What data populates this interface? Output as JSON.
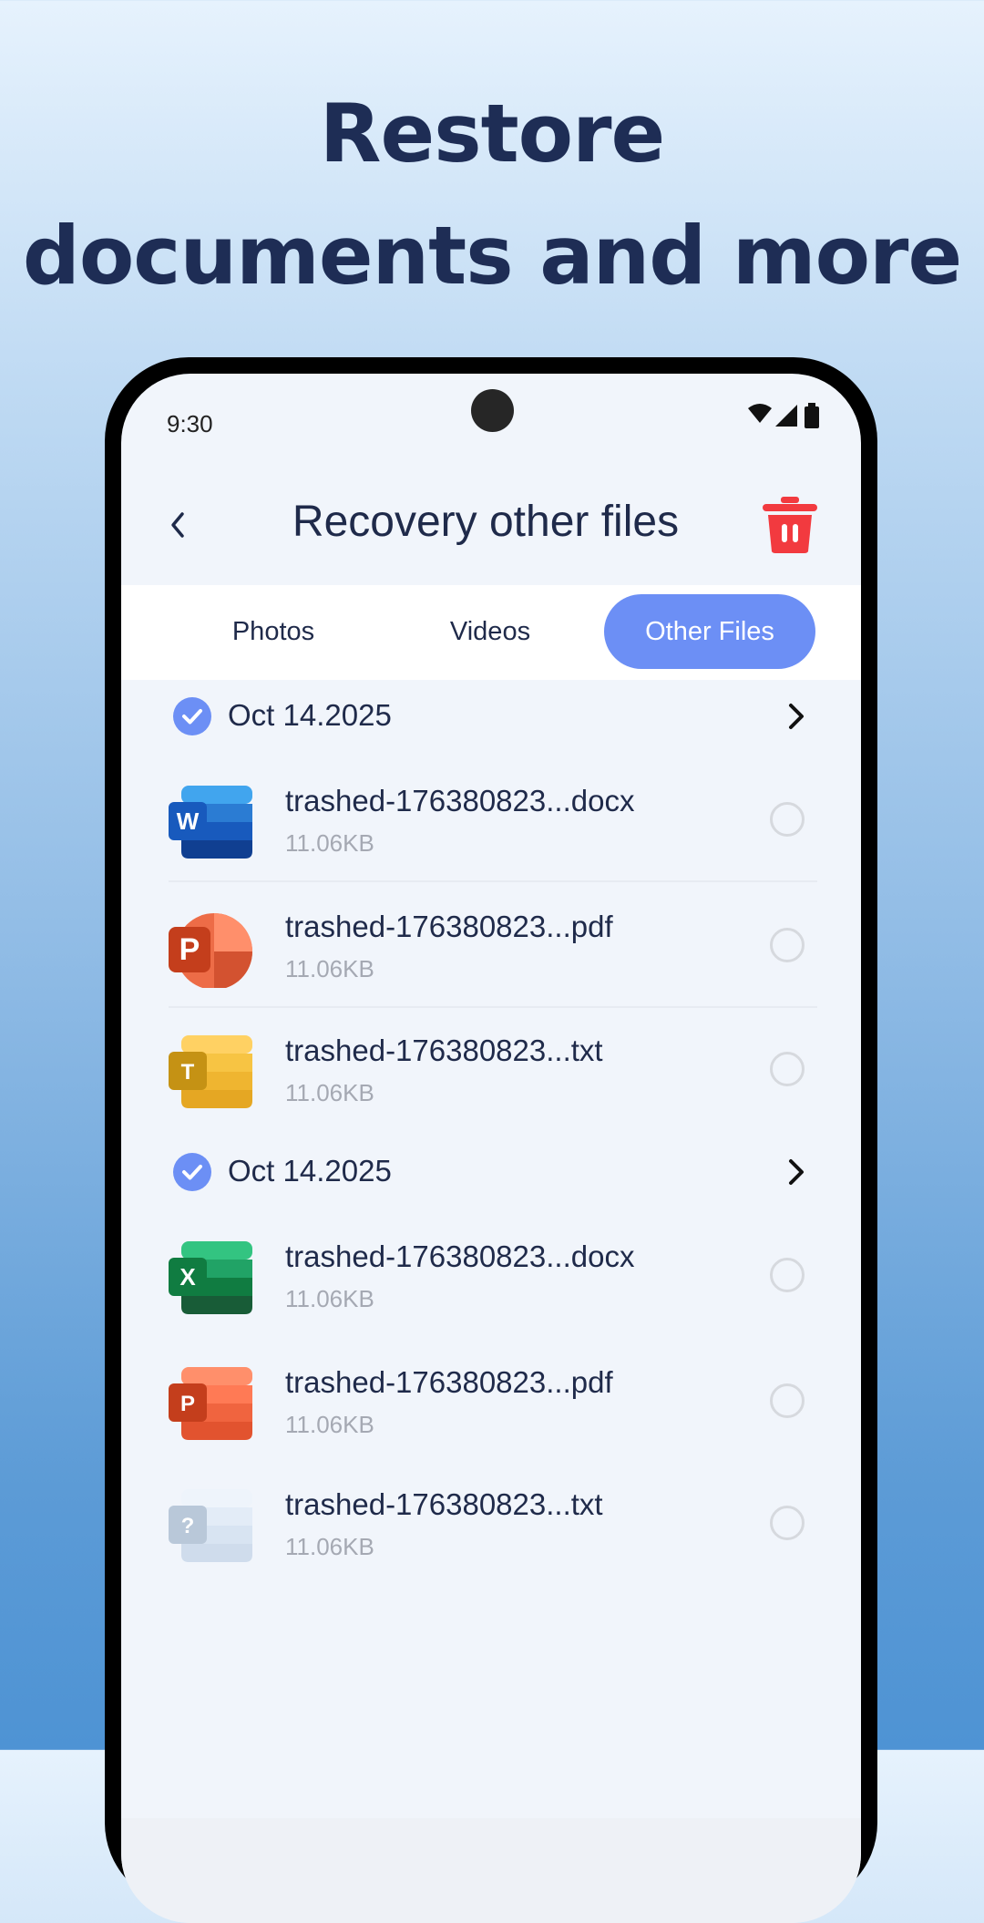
{
  "headline": {
    "line1": "Restore",
    "line2": "documents and more"
  },
  "status_bar": {
    "time": "9:30"
  },
  "header": {
    "title": "Recovery other files"
  },
  "tabs": [
    {
      "label": "Photos",
      "active": false
    },
    {
      "label": "Videos",
      "active": false
    },
    {
      "label": "Other Files",
      "active": true
    }
  ],
  "colors": {
    "accent": "#6c8ff5",
    "delete": "#f23a3f",
    "title": "#1e2d55"
  },
  "groups": [
    {
      "date": "Oct 14.2025",
      "files": [
        {
          "name": "trashed-176380823...docx",
          "size": "11.06KB",
          "icon": "word-icon"
        },
        {
          "name": "trashed-176380823...pdf",
          "size": "11.06KB",
          "icon": "powerpoint-icon"
        },
        {
          "name": "trashed-176380823...txt",
          "size": "11.06KB",
          "icon": "text-file-icon"
        }
      ]
    },
    {
      "date": "Oct 14.2025",
      "files": [
        {
          "name": "trashed-176380823...docx",
          "size": "11.06KB",
          "icon": "excel-icon"
        },
        {
          "name": "trashed-176380823...pdf",
          "size": "11.06KB",
          "icon": "pdf-icon"
        },
        {
          "name": "trashed-176380823...txt",
          "size": "11.06KB",
          "icon": "unknown-file-icon"
        }
      ]
    }
  ]
}
